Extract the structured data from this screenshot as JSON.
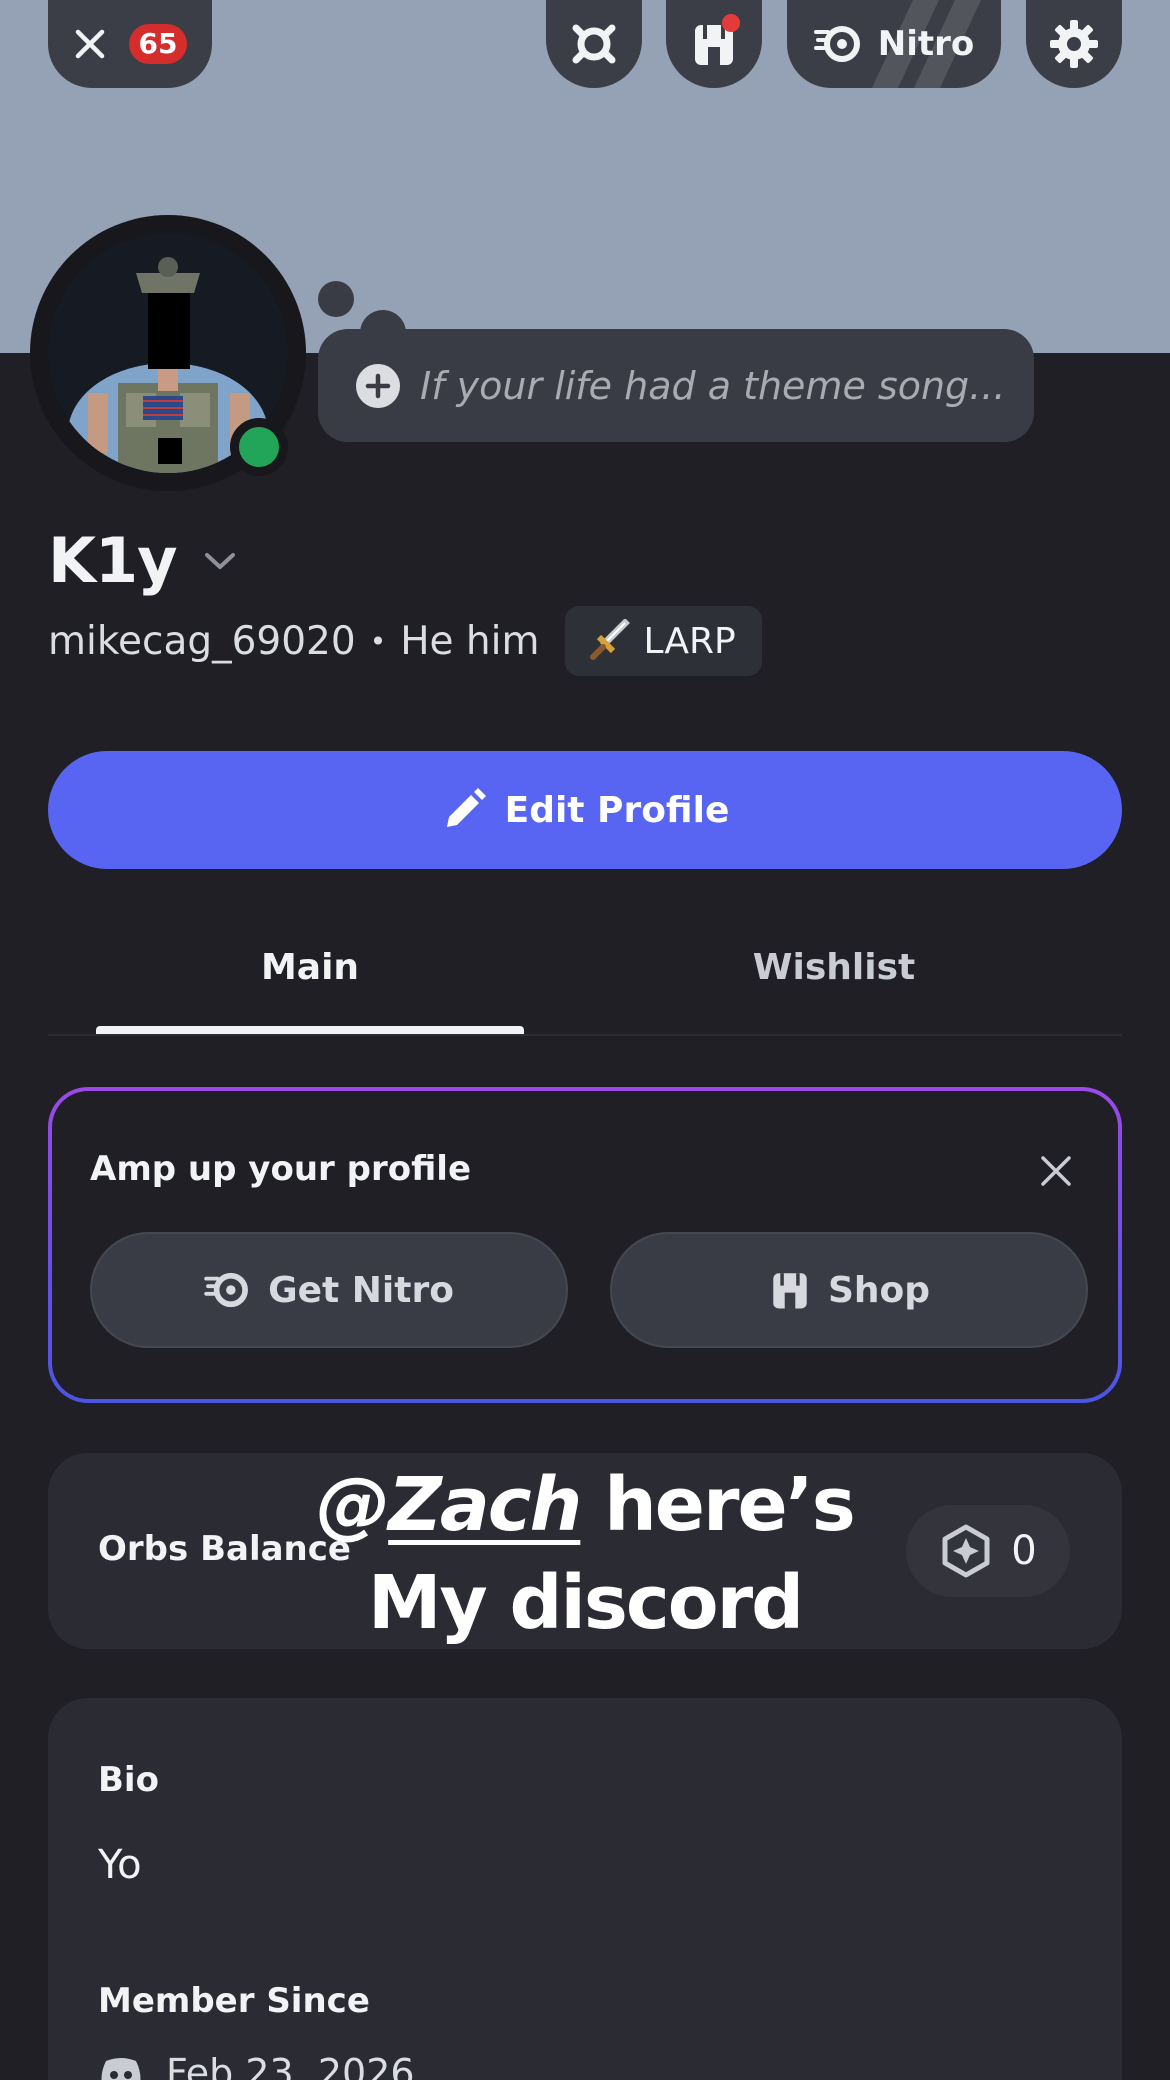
{
  "header": {
    "notification_count": "65",
    "nitro_label": "Nitro"
  },
  "profile": {
    "status_placeholder": "If your life had a theme song...",
    "display_name": "K1y",
    "username": "mikecag_69020",
    "separator": "•",
    "pronouns": "He him",
    "tag_label": "LARP",
    "online_color": "#23a559"
  },
  "actions": {
    "edit_profile_label": "Edit Profile"
  },
  "tabs": [
    {
      "label": "Main",
      "active": true
    },
    {
      "label": "Wishlist",
      "active": false
    }
  ],
  "amp_card": {
    "title": "Amp up your profile",
    "get_nitro_label": "Get Nitro",
    "shop_label": "Shop"
  },
  "orbs": {
    "label": "Orbs Balance",
    "value": "0"
  },
  "overlay_caption": {
    "mention_at": "@",
    "mention_name": "Zach",
    "line1_rest": " here’s",
    "line2": "My discord"
  },
  "bio": {
    "title": "Bio",
    "text": "Yo",
    "member_since_title": "Member Since",
    "member_since_date": "Feb 23, 2026"
  },
  "colors": {
    "accent": "#5865f2",
    "banner": "#95a1b4",
    "background": "#1f1f25",
    "badge_red": "#d52c2c"
  }
}
